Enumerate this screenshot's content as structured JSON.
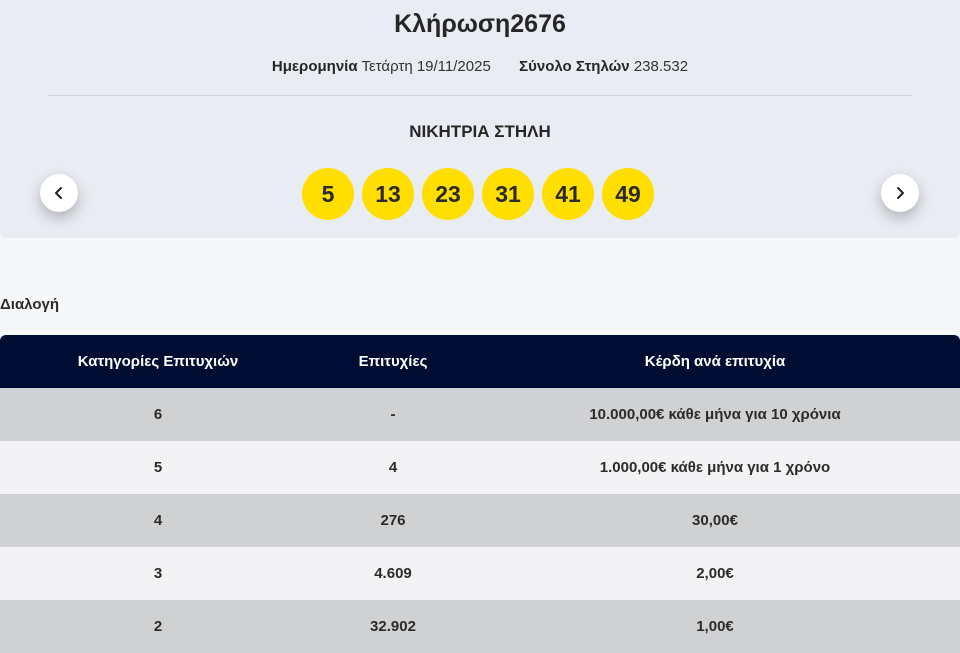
{
  "draw": {
    "title": "Κλήρωση2676",
    "date_label": "Ημερομηνία",
    "date_value": "Τετάρτη 19/11/2025",
    "columns_label": "Σύνολο Στηλών",
    "columns_value": "238.532",
    "winning_title": "ΝΙΚΗΤΡΙΑ ΣΤΗΛΗ",
    "numbers": [
      "5",
      "13",
      "23",
      "31",
      "41",
      "49"
    ],
    "ball_color": "#ffde00"
  },
  "nav": {
    "prev_icon": "chevron-left-icon",
    "next_icon": "chevron-right-icon"
  },
  "section": {
    "label": "Διαλογή"
  },
  "table": {
    "headers": [
      "Κατηγορίες Επιτυχιών",
      "Επιτυχίες",
      "Κέρδη ανά επιτυχία"
    ],
    "header_color": "#000d33",
    "rows": [
      [
        "6",
        "-",
        "10.000,00€ κάθε μήνα για 10 χρόνια"
      ],
      [
        "5",
        "4",
        "1.000,00€ κάθε μήνα για 1 χρόνο"
      ],
      [
        "4",
        "276",
        "30,00€"
      ],
      [
        "3",
        "4.609",
        "2,00€"
      ],
      [
        "2",
        "32.902",
        "1,00€"
      ]
    ]
  }
}
